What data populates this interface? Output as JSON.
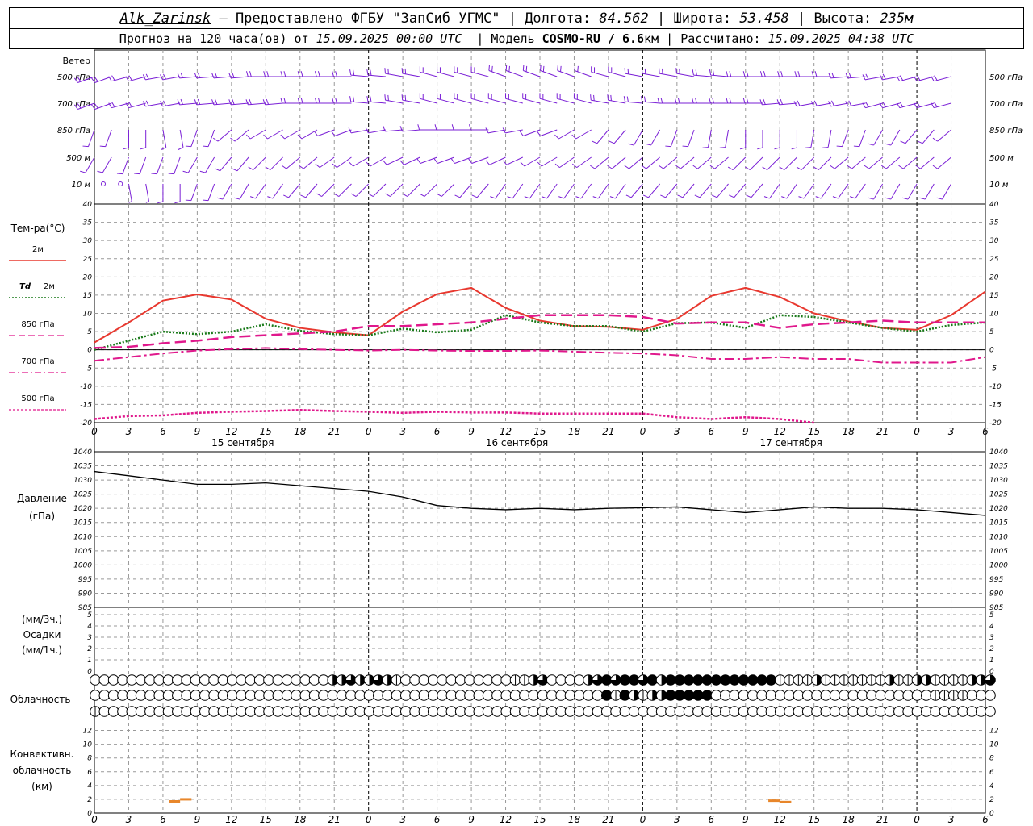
{
  "header": {
    "station": "Alk_Zarinsk",
    "provider": "– Предоставлено ФГБУ \"ЗапСиб УГМС\"",
    "lon_label": "Долгота:",
    "lon": "84.562",
    "lat_label": "Широта:",
    "lat": "53.458",
    "alt_label": "Высота:",
    "alt": "235м",
    "forecast_label": "Прогноз на 120 часа(ов) от",
    "forecast_start": "15.09.2025 00:00 UTC",
    "model_label": "Модель",
    "model": "COSMO-RU / 6.6",
    "model_unit": "км",
    "calc_label": "Рассчитано:",
    "calc_time": "15.09.2025 04:38 UTC"
  },
  "labels": {
    "wind_title": "Ветер",
    "wind_levels": [
      "500 гПа",
      "700 гПа",
      "850 гПа",
      "500 м",
      "10  м"
    ],
    "temp_title": "Тем-ра(°С)",
    "temp_2m": "2м",
    "td_prefix": "Td",
    "td_2m": "2м",
    "t850": "850 гПа",
    "t700": "700 гПа",
    "t500": "500 гПа",
    "pressure_title": "Давление",
    "pressure_unit": "(гПа)",
    "precip_unit1": "(мм/3ч.)",
    "precip_title": "Осадки",
    "precip_unit2": "(мм/1ч.)",
    "cloud_title": "Облачность",
    "conv_title1": "Конвективн.",
    "conv_title2": "облачность",
    "conv_unit": "(км)"
  },
  "colors": {
    "wind": "#7a1fd6",
    "t2m": "#e8382f",
    "td2m": "#1a7a1a",
    "t850": "#e0188c",
    "t700": "#e0188c",
    "t500": "#e0188c",
    "pressure": "#000000",
    "conv": "#e8862a",
    "grid": "#999999"
  },
  "chart_data": [
    {
      "type": "line",
      "name": "temperature",
      "x_hours": [
        0,
        3,
        6,
        9,
        12,
        15,
        18,
        21,
        24,
        27,
        30,
        33,
        36,
        39,
        42,
        45,
        48,
        51,
        54,
        57,
        60,
        63,
        66,
        69,
        72,
        75,
        78
      ],
      "xlim": [
        0,
        78
      ],
      "x_tick_labels": [
        "0",
        "3",
        "6",
        "9",
        "12",
        "15",
        "18",
        "21",
        "0",
        "3",
        "6",
        "9",
        "12",
        "15",
        "18",
        "21",
        "0",
        "3",
        "6",
        "9",
        "12",
        "15",
        "18",
        "21",
        "0",
        "3",
        "6"
      ],
      "day_labels": [
        {
          "hour": 12,
          "text": "15 сентября"
        },
        {
          "hour": 36,
          "text": "16 сентября"
        },
        {
          "hour": 60,
          "text": "17 сентября"
        }
      ],
      "ylim": [
        -20,
        40
      ],
      "y_ticks": [
        -20,
        -15,
        -10,
        -5,
        0,
        5,
        10,
        15,
        20,
        25,
        30,
        35,
        40
      ],
      "series": [
        {
          "name": "2м",
          "key": "t2m",
          "style": "solid",
          "values": [
            2.0,
            7.5,
            13.5,
            15.2,
            13.8,
            8.5,
            6.0,
            4.8,
            4.0,
            10.5,
            15.3,
            17.0,
            11.5,
            8.0,
            6.5,
            6.3,
            5.5,
            8.5,
            14.8,
            17.0,
            14.5,
            10.0,
            7.8,
            6.0,
            5.5,
            9.5,
            16.0
          ]
        },
        {
          "name": "Td 2м",
          "key": "td2m",
          "style": "dotted",
          "values": [
            0.0,
            2.5,
            5.0,
            4.3,
            5.0,
            7.0,
            5.2,
            4.3,
            4.0,
            5.8,
            4.8,
            5.5,
            9.5,
            7.5,
            6.5,
            6.5,
            5.0,
            7.3,
            7.5,
            6.0,
            9.5,
            9.0,
            7.5,
            6.0,
            5.0,
            6.8,
            7.5
          ]
        },
        {
          "name": "850 гПа",
          "key": "t850",
          "style": "dashed",
          "values": [
            0.5,
            0.8,
            1.8,
            2.5,
            3.5,
            4.0,
            4.5,
            5.0,
            6.5,
            6.5,
            7.0,
            7.5,
            8.5,
            9.5,
            9.5,
            9.5,
            9.0,
            7.2,
            7.5,
            7.5,
            6.0,
            7.0,
            7.5,
            8.0,
            7.5,
            7.5,
            7.5
          ]
        },
        {
          "name": "700 гПа",
          "key": "t700",
          "style": "dashdot",
          "values": [
            -3.0,
            -2.0,
            -1.0,
            -0.2,
            0.2,
            0.5,
            0.2,
            0.0,
            -0.2,
            0.0,
            -0.2,
            -0.3,
            -0.3,
            -0.2,
            -0.5,
            -0.8,
            -1.0,
            -1.5,
            -2.5,
            -2.5,
            -2.0,
            -2.5,
            -2.5,
            -3.5,
            -3.5,
            -3.5,
            -2.0
          ]
        },
        {
          "name": "500 гПа",
          "key": "t500",
          "style": "dotted-thick",
          "values": [
            -19.0,
            -18.2,
            -18.0,
            -17.3,
            -17.0,
            -16.8,
            -16.5,
            -16.8,
            -17.0,
            -17.3,
            -17.0,
            -17.2,
            -17.2,
            -17.5,
            -17.5,
            -17.5,
            -17.5,
            -18.5,
            -19.0,
            -18.5,
            -19.0,
            -20.0
          ]
        }
      ]
    },
    {
      "type": "line",
      "name": "pressure",
      "x_hours": [
        0,
        3,
        6,
        9,
        12,
        15,
        18,
        21,
        24,
        27,
        30,
        33,
        36,
        39,
        42,
        45,
        48,
        51,
        54,
        57,
        60,
        63,
        66,
        69,
        72,
        75,
        78
      ],
      "ylim": [
        985,
        1040
      ],
      "y_ticks": [
        985,
        990,
        995,
        1000,
        1005,
        1010,
        1015,
        1020,
        1025,
        1030,
        1035,
        1040
      ],
      "series": [
        {
          "name": "Давление",
          "values": [
            1033,
            1031.5,
            1030,
            1028.5,
            1028.5,
            1029,
            1028,
            1027,
            1026,
            1024,
            1021,
            1020,
            1019.5,
            1020,
            1019.5,
            1020,
            1020.2,
            1020.5,
            1019.5,
            1018.5,
            1019.5,
            1020.5,
            1020,
            1020,
            1019.5,
            1018.5,
            1017.5
          ]
        }
      ]
    },
    {
      "type": "bar",
      "name": "precipitation",
      "ylim": [
        0,
        5
      ],
      "y_ticks": [
        0,
        1,
        2,
        3,
        4,
        5
      ],
      "x_hours": [],
      "values": []
    },
    {
      "type": "scatter",
      "name": "convective_cloud",
      "ylim": [
        0,
        13
      ],
      "y_ticks": [
        0,
        2,
        4,
        6,
        8,
        10,
        12
      ],
      "segments": [
        {
          "x": [
            6.5,
            7.5
          ],
          "y": 1.7
        },
        {
          "x": [
            7.5,
            8.5
          ],
          "y": 2.0
        },
        {
          "x": [
            59.0,
            60.0
          ],
          "y": 1.8
        },
        {
          "x": [
            60.0,
            61.0
          ],
          "y": 1.6
        }
      ]
    }
  ],
  "cloud_cover": {
    "note_levels": [
      "high",
      "mid",
      "low"
    ],
    "high": [
      0,
      0,
      0,
      0,
      0,
      0,
      0,
      0,
      0,
      0,
      0,
      0,
      0,
      0,
      0,
      0,
      0,
      0,
      0,
      0,
      0,
      0,
      0,
      0,
      0,
      0,
      2,
      2,
      3,
      2,
      2,
      3,
      2,
      1,
      0,
      0,
      0,
      0,
      0,
      0,
      0,
      0,
      0,
      0,
      0,
      0,
      1,
      1,
      2,
      3,
      0,
      0,
      0,
      0,
      2,
      3,
      4,
      3,
      4,
      4,
      3,
      4,
      2,
      4,
      4,
      4,
      4,
      4,
      4,
      4,
      4,
      4,
      4,
      4,
      4,
      1,
      1,
      1,
      1,
      2,
      1,
      1,
      1,
      1,
      1,
      1,
      1,
      2,
      1,
      1,
      2,
      2,
      1,
      1,
      1,
      1,
      2,
      2,
      3
    ],
    "mid": [
      0,
      0,
      0,
      0,
      0,
      0,
      0,
      0,
      0,
      0,
      0,
      0,
      0,
      0,
      0,
      0,
      0,
      0,
      0,
      0,
      0,
      0,
      0,
      0,
      0,
      0,
      0,
      0,
      0,
      0,
      0,
      0,
      0,
      0,
      0,
      0,
      0,
      0,
      0,
      0,
      0,
      0,
      0,
      0,
      0,
      0,
      0,
      0,
      0,
      0,
      0,
      0,
      0,
      0,
      0,
      0,
      4,
      1,
      4,
      2,
      1,
      2,
      2,
      4,
      4,
      4,
      4,
      4,
      0,
      0,
      0,
      0,
      0,
      0,
      0,
      0,
      0,
      0,
      0,
      0,
      0,
      0,
      0,
      0,
      0,
      0,
      0,
      0,
      0,
      0,
      0,
      0,
      1,
      1,
      1,
      1,
      0,
      0,
      0
    ],
    "low": [
      1,
      0,
      0,
      0,
      0,
      0,
      0,
      0,
      0,
      0,
      0,
      0,
      0,
      0,
      0,
      0,
      0,
      0,
      0,
      0,
      0,
      0,
      0,
      0,
      0,
      0,
      0,
      0,
      0,
      0,
      0,
      0,
      0,
      0,
      0,
      0,
      0,
      0,
      0,
      0,
      0,
      0,
      0,
      0,
      0,
      0,
      0,
      0,
      0,
      0,
      0,
      0,
      0,
      0,
      0,
      0,
      0,
      0,
      0,
      0,
      0,
      0,
      0,
      0,
      0,
      0,
      0,
      0,
      0,
      0,
      0,
      0,
      0,
      0,
      0,
      0,
      0,
      0,
      0,
      0,
      0,
      0,
      0,
      0,
      0,
      0,
      0,
      0,
      0,
      0,
      0,
      0,
      0,
      0,
      0,
      0,
      0,
      0,
      0
    ]
  },
  "wind_barbs": {
    "levels": [
      "500hPa",
      "700hPa",
      "850hPa",
      "500m",
      "10m"
    ],
    "dir_deg": [
      [
        250,
        255,
        260,
        265,
        265,
        270,
        270,
        270,
        275,
        280,
        285,
        285,
        290,
        290,
        290,
        285,
        280,
        280,
        275,
        270,
        270,
        270,
        265,
        260,
        255,
        255,
        260
      ],
      [
        250,
        255,
        260,
        265,
        265,
        265,
        270,
        270,
        275,
        280,
        285,
        285,
        285,
        285,
        285,
        280,
        275,
        270,
        270,
        270,
        265,
        260,
        260,
        255,
        255,
        255,
        260
      ],
      [
        200,
        180,
        170,
        200,
        230,
        240,
        240,
        250,
        260,
        265,
        270,
        270,
        260,
        250,
        240,
        220,
        210,
        200,
        190,
        180,
        180,
        190,
        200,
        210,
        220,
        230,
        230
      ],
      [
        210,
        200,
        200,
        210,
        220,
        225,
        230,
        235,
        240,
        245,
        250,
        250,
        245,
        240,
        235,
        230,
        230,
        230,
        230,
        225,
        225,
        225,
        230,
        230,
        230,
        230,
        230
      ],
      [
        0,
        170,
        180,
        200,
        210,
        215,
        220,
        225,
        225,
        225,
        225,
        220,
        215,
        215,
        215,
        215,
        220,
        220,
        220,
        220,
        215,
        215,
        215,
        210,
        210,
        210,
        210
      ]
    ],
    "speed_kt": [
      [
        40,
        40,
        40,
        35,
        35,
        30,
        30,
        25,
        25,
        20,
        20,
        20,
        25,
        25,
        30,
        30,
        30,
        30,
        25,
        25,
        25,
        25,
        20,
        20,
        20,
        20,
        20
      ],
      [
        35,
        35,
        30,
        30,
        25,
        25,
        25,
        20,
        20,
        20,
        20,
        25,
        25,
        25,
        25,
        20,
        20,
        20,
        20,
        20,
        20,
        20,
        20,
        20,
        20,
        20,
        20
      ],
      [
        10,
        10,
        10,
        10,
        15,
        15,
        15,
        15,
        15,
        15,
        15,
        15,
        15,
        10,
        10,
        10,
        10,
        10,
        10,
        10,
        10,
        10,
        10,
        10,
        10,
        10,
        10
      ],
      [
        15,
        15,
        15,
        15,
        15,
        15,
        15,
        15,
        15,
        15,
        15,
        15,
        15,
        15,
        15,
        15,
        15,
        15,
        15,
        10,
        10,
        10,
        10,
        10,
        10,
        10,
        10
      ],
      [
        0,
        5,
        10,
        10,
        10,
        10,
        10,
        10,
        10,
        10,
        10,
        10,
        10,
        10,
        10,
        10,
        10,
        10,
        10,
        10,
        10,
        10,
        10,
        10,
        10,
        10,
        10
      ]
    ]
  }
}
